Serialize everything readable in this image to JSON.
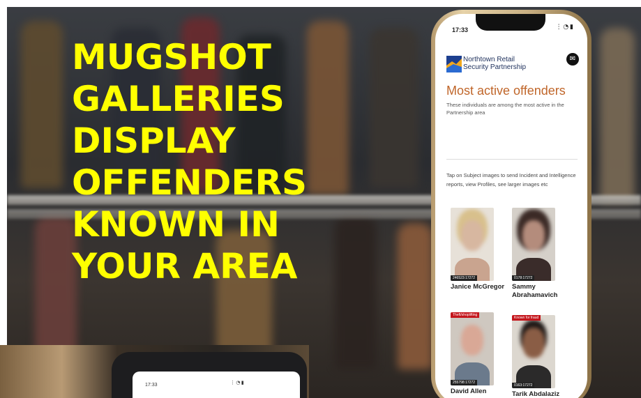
{
  "headline": [
    "MUGSHOT",
    "GALLERIES",
    "DISPLAY",
    "OFFENDERS",
    "KNOWN IN",
    "YOUR AREA"
  ],
  "phone": {
    "status_time": "17:33",
    "status_icons": "⋮ ◔ ▮",
    "org_name_line1": "Northtown Retail",
    "org_name_line2": "Security Partnership",
    "mail_icon": "✉",
    "page_title": "Most active offenders",
    "page_description": "These individuals are among the most active in the Partnership area",
    "instructions": "Tap on Subject images to send Incident and Intelligence reports, view Profiles, see larger images etc",
    "offenders": [
      {
        "name": "Janice McGregor",
        "ref": "246523:17272",
        "tag": ""
      },
      {
        "name": "Sammy Abrahamavich",
        "ref": "0178:17272",
        "tag": ""
      },
      {
        "name": "David Allen",
        "ref": "255798:17272",
        "tag": "Theft/shoplifting"
      },
      {
        "name": "Tarik Abdalaziz",
        "ref": "0163:17272",
        "tag": "Known for fraud"
      }
    ]
  },
  "second_phone": {
    "status_time": "17:33",
    "status_icons": "⋮ ◔ ▮"
  },
  "colors": {
    "headline": "#ffff00",
    "title": "#c0662a",
    "tag": "#c4161c",
    "org": "#1d2f5b"
  }
}
